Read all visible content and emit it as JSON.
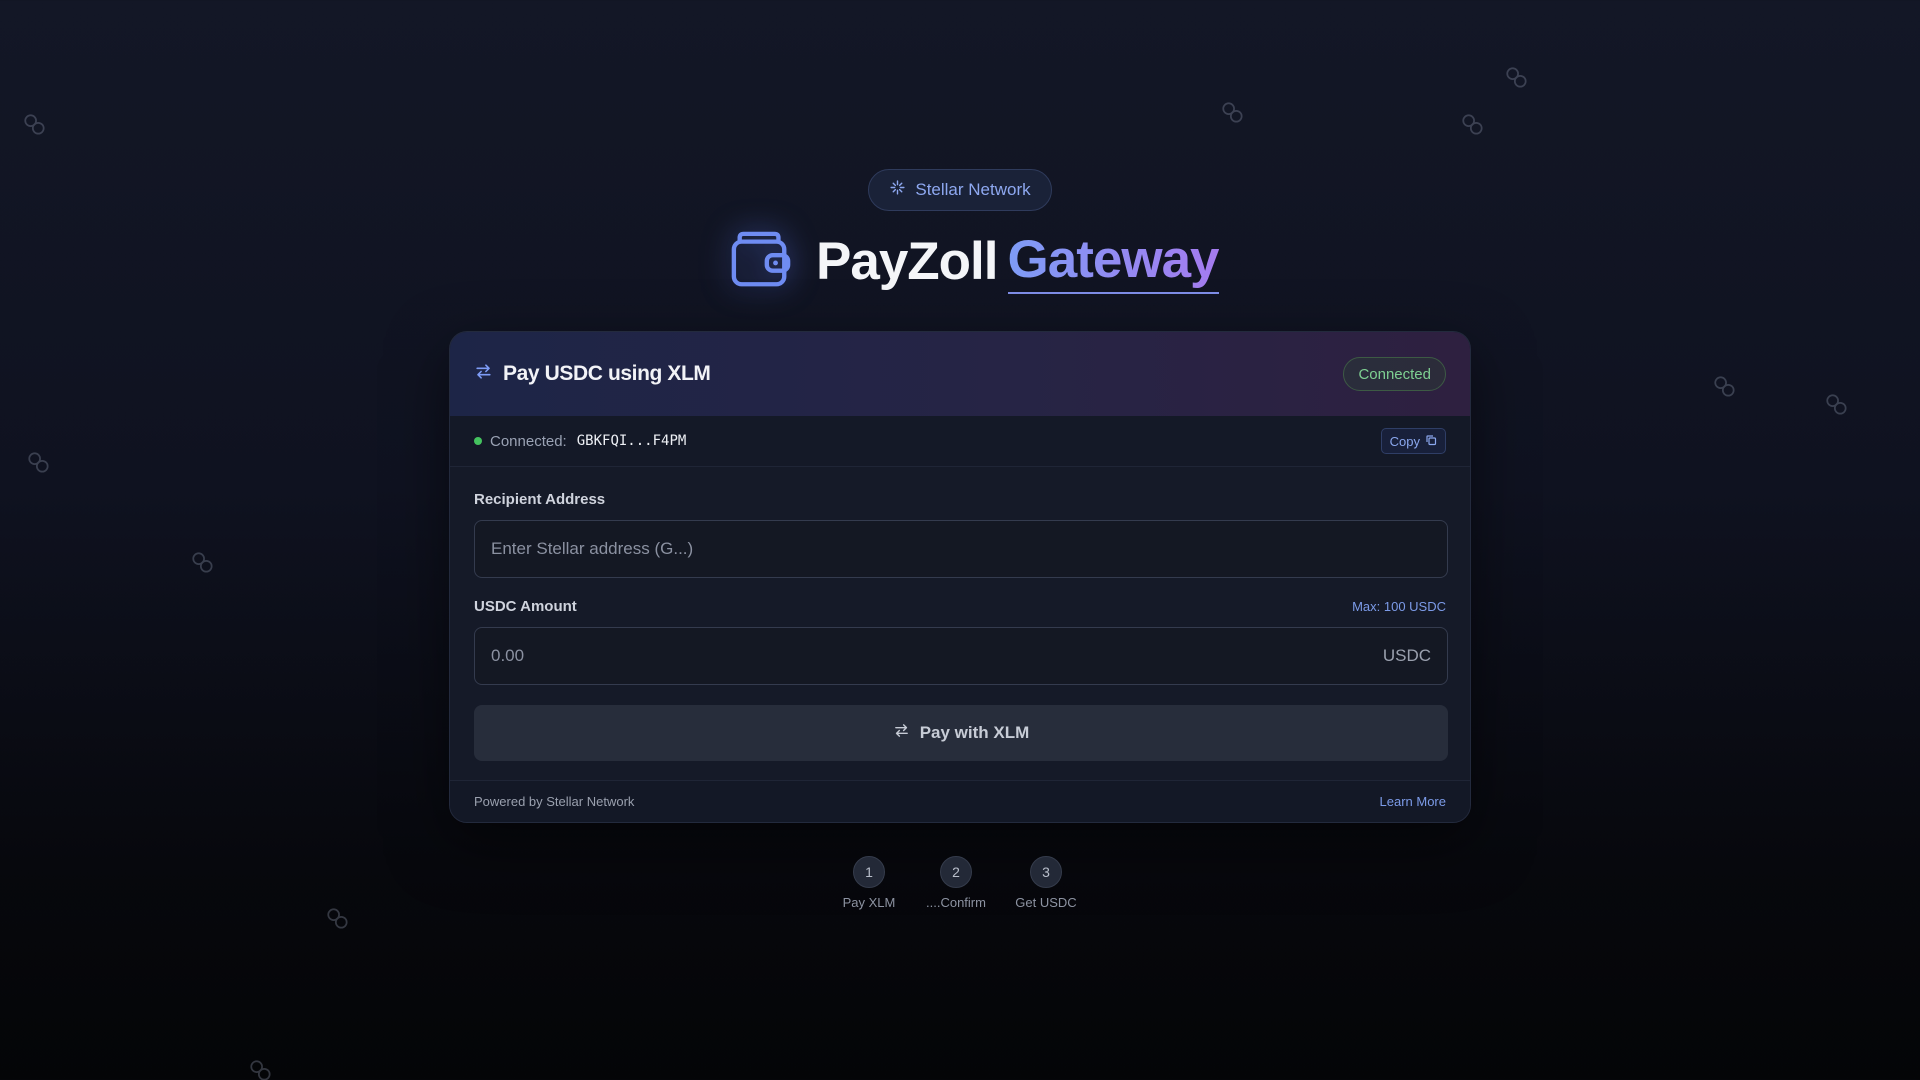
{
  "network_badge": {
    "icon": "sparkles-icon",
    "label": "Stellar Network"
  },
  "hero": {
    "icon": "wallet-icon",
    "title": "PayZoll",
    "accent": "Gateway"
  },
  "card": {
    "header": {
      "icon": "swap-arrows-icon",
      "title": "Pay USDC using XLM",
      "status": "Connected"
    },
    "connection": {
      "label": "Connected:",
      "address": "GBKFQI...F4PM",
      "copy_label": "Copy",
      "copy_icon": "copy-icon"
    },
    "recipient": {
      "label": "Recipient Address",
      "placeholder": "Enter Stellar address (G...)"
    },
    "amount": {
      "label": "USDC Amount",
      "hint": "Max: 100 USDC",
      "placeholder": "0.00",
      "suffix": "USDC"
    },
    "pay_button": {
      "icon": "swap-arrows-icon",
      "label": "Pay with XLM"
    },
    "footer": {
      "left": "Powered by Stellar Network",
      "link": "Learn More"
    }
  },
  "steps": [
    {
      "number": "1",
      "label": "Pay XLM"
    },
    {
      "number": "2",
      "label": "....Confirm"
    },
    {
      "number": "3",
      "label": "Get USDC"
    }
  ],
  "colors": {
    "accent": "#8ea8f0",
    "gradient_start": "#7e9cf6",
    "gradient_end": "#a57bef",
    "success": "#7ed092",
    "background": "#0f1220"
  }
}
